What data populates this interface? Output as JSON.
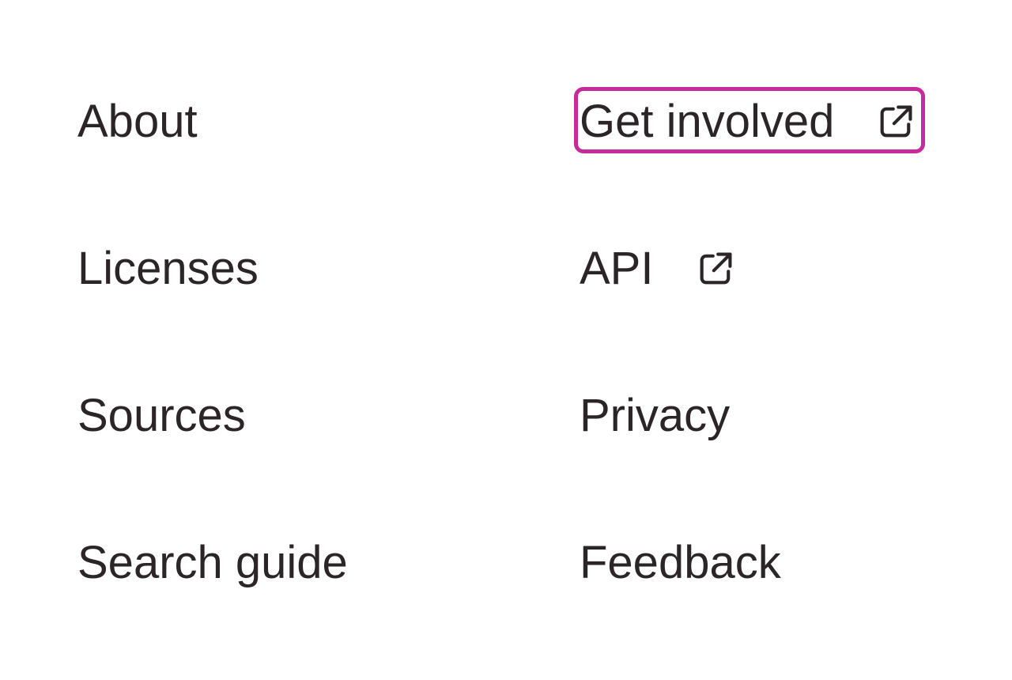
{
  "footer_nav": {
    "left_column": [
      {
        "label": "About"
      },
      {
        "label": "Licenses"
      },
      {
        "label": "Sources"
      },
      {
        "label": "Search guide"
      }
    ],
    "right_column": [
      {
        "label": "Get involved",
        "icon": "external-link-icon",
        "focused": true
      },
      {
        "label": "API",
        "icon": "external-link-icon"
      },
      {
        "label": "Privacy"
      },
      {
        "label": "Feedback"
      }
    ]
  },
  "colors": {
    "text": "#2b2528",
    "focus_ring": "#c52b9b",
    "background": "#ffffff"
  }
}
